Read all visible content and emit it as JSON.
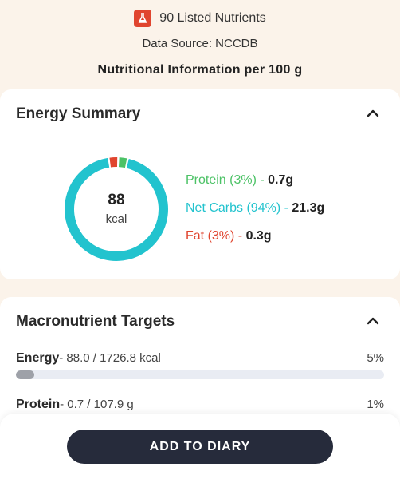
{
  "header": {
    "nutrient_count": "90 Listed Nutrients",
    "data_source": "Data Source: NCCDB",
    "per_100g": "Nutritional Information per 100 g",
    "flask_icon": "flask-icon",
    "flask_color": "#e0452f"
  },
  "energy_summary": {
    "title": "Energy Summary",
    "collapse_icon": "chevron-up-icon",
    "kcal_value": "88",
    "kcal_unit": "kcal",
    "macros": [
      {
        "name": "Protein (3%)",
        "sep": " - ",
        "amount": "0.7g",
        "percent": 3,
        "color": "#4cc266"
      },
      {
        "name": "Net Carbs (94%)",
        "sep": " - ",
        "amount": "21.3g",
        "percent": 94,
        "color": "#22c3ce"
      },
      {
        "name": "Fat (3%)",
        "sep": " - ",
        "amount": "0.3g",
        "percent": 3,
        "color": "#e0452f"
      }
    ]
  },
  "macro_targets": {
    "title": "Macronutrient Targets",
    "collapse_icon": "chevron-up-icon",
    "rows": [
      {
        "label": "Energy",
        "amount": "- 88.0 / 1726.8 kcal",
        "pct": "5%",
        "fill": 0.05
      },
      {
        "label": "Protein",
        "amount": "- 0.7 / 107.9 g",
        "pct": "1%"
      }
    ]
  },
  "footer": {
    "add_label": "ADD TO DIARY"
  }
}
